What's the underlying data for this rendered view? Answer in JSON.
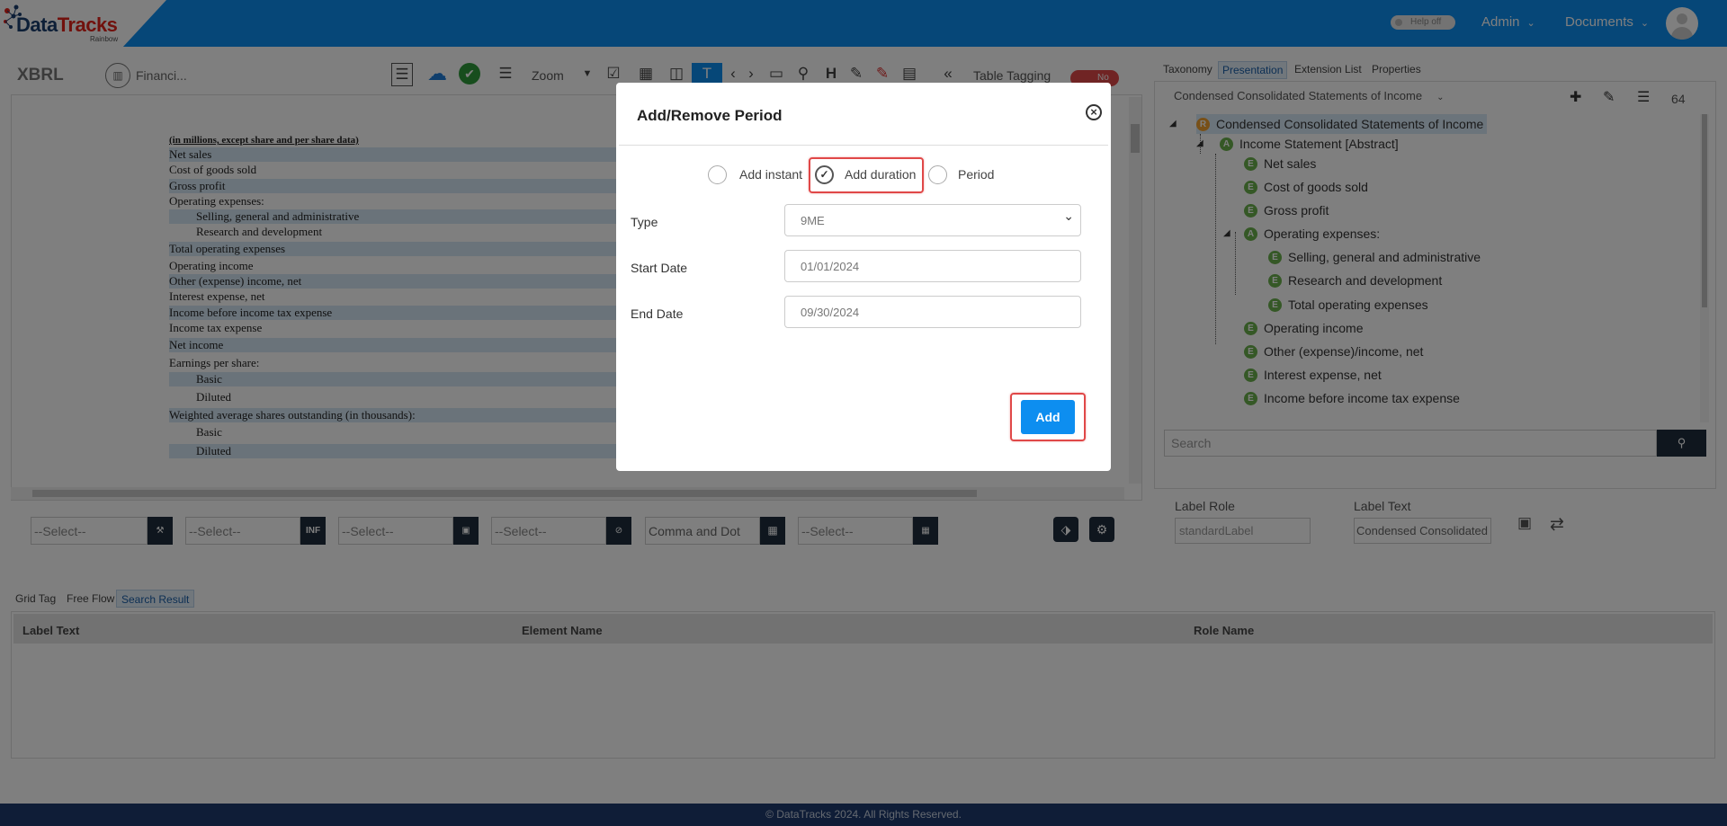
{
  "header": {
    "logo_main": "Data",
    "logo_accent": "Tracks",
    "logo_sub": "Rainbow",
    "help_toggle": "Help off",
    "admin_menu": "Admin",
    "documents_menu": "Documents",
    "brand_color": "#0d8ef0"
  },
  "toolbar": {
    "xbrl_label": "XBRL",
    "document_name": "Financi...",
    "zoom_label": "Zoom",
    "table_tagging_label": "Table Tagging",
    "table_tagging_state": "No"
  },
  "financial_statement": {
    "heading": "(in millions, except share and per share data)",
    "rows": [
      "Net sales",
      "Cost of goods sold",
      "Gross profit",
      "Operating expenses:",
      "Selling, general and administrative",
      "Research and development",
      "Total operating expenses",
      "Operating income",
      "Other (expense) income, net",
      "Interest expense, net",
      "Income before income tax expense",
      "Income tax expense",
      "Net income",
      "Earnings per share:",
      "Basic",
      "Diluted",
      "Weighted average shares outstanding (in thousands):",
      "Basic",
      "Diluted"
    ]
  },
  "selectors": {
    "select_placeholder": "--Select--",
    "number_format": "Comma and Dot"
  },
  "bottom_tabs": {
    "grid_tag": "Grid Tag",
    "free_flow": "Free Flow",
    "search_result": "Search Result"
  },
  "results_table": {
    "columns": [
      "Label Text",
      "Element Name",
      "Role Name"
    ]
  },
  "right_panel": {
    "tabs": [
      "Taxonomy",
      "Presentation",
      "Extension List",
      "Properties"
    ],
    "statement_select": "Condensed Consolidated Statements of Income",
    "count": "64",
    "tree": [
      {
        "badge": "R",
        "label": "Condensed Consolidated Statements of Income"
      },
      {
        "badge": "A",
        "label": "Income Statement [Abstract]"
      },
      {
        "badge": "E",
        "label": "Net sales"
      },
      {
        "badge": "E",
        "label": "Cost of goods sold"
      },
      {
        "badge": "E",
        "label": "Gross profit"
      },
      {
        "badge": "A",
        "label": "Operating expenses:"
      },
      {
        "badge": "E",
        "label": "Selling, general and administrative"
      },
      {
        "badge": "E",
        "label": "Research and development"
      },
      {
        "badge": "E",
        "label": "Total operating expenses"
      },
      {
        "badge": "E",
        "label": "Operating income"
      },
      {
        "badge": "E",
        "label": "Other (expense)/income, net"
      },
      {
        "badge": "E",
        "label": "Interest expense, net"
      },
      {
        "badge": "E",
        "label": "Income before income tax expense"
      }
    ],
    "search_placeholder": "Search",
    "label_role_title": "Label Role",
    "label_role_value": "standardLabel",
    "label_text_title": "Label Text",
    "label_text_value": "Condensed Consolidated Statements of Income"
  },
  "modal": {
    "title": "Add/Remove Period",
    "options": [
      "Add instant",
      "Add duration",
      "Period"
    ],
    "selected_option": "Add duration",
    "type_label": "Type",
    "type_value": "9ME",
    "start_label": "Start Date",
    "start_value": "01/01/2024",
    "end_label": "End Date",
    "end_value": "09/30/2024",
    "add_button": "Add"
  },
  "footer": {
    "copyright": "© DataTracks 2024. All Rights Reserved."
  }
}
